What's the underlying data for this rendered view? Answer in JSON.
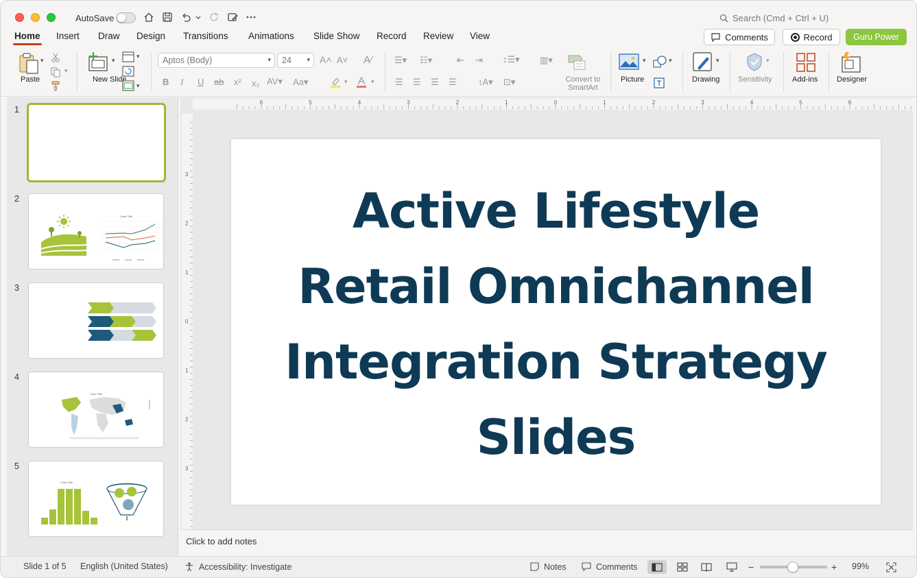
{
  "titlebar": {
    "autosave_label": "AutoSave",
    "search_placeholder": "Search (Cmd + Ctrl + U)"
  },
  "tabs": [
    {
      "label": "Home",
      "active": true
    },
    {
      "label": "Insert"
    },
    {
      "label": "Draw"
    },
    {
      "label": "Design"
    },
    {
      "label": "Transitions"
    },
    {
      "label": "Animations"
    },
    {
      "label": "Slide Show"
    },
    {
      "label": "Record"
    },
    {
      "label": "Review"
    },
    {
      "label": "View"
    }
  ],
  "actions": {
    "comments": "Comments",
    "record": "Record",
    "guru": "Guru Power"
  },
  "ribbon": {
    "paste": "Paste",
    "new_slide": "New Slide",
    "font_name": "Aptos (Body)",
    "font_size": "24",
    "convert_smartart": "Convert to SmartArt",
    "picture": "Picture",
    "drawing": "Drawing",
    "sensitivity": "Sensitivity",
    "addins": "Add-ins",
    "designer": "Designer"
  },
  "ruler": {
    "h_ticks": [
      "6",
      "5",
      "4",
      "3",
      "2",
      "1",
      "0",
      "1",
      "2",
      "3",
      "4",
      "5",
      "6"
    ],
    "v_ticks": [
      "3",
      "2",
      "1",
      "0",
      "1",
      "2",
      "3"
    ]
  },
  "thumbnails": [
    {
      "num": "1",
      "selected": true
    },
    {
      "num": "2",
      "chart_title": "Chart Title"
    },
    {
      "num": "3"
    },
    {
      "num": "4",
      "chart_title": "Chart Title"
    },
    {
      "num": "5",
      "chart_title": "Chart Title"
    }
  ],
  "slide": {
    "title_lines": [
      "Active Lifestyle",
      "Retail Omnichannel",
      "Integration Strategy",
      "Slides"
    ]
  },
  "notes": {
    "placeholder": "Click to add notes"
  },
  "statusbar": {
    "slide_info": "Slide 1 of 5",
    "language": "English (United States)",
    "accessibility": "Accessibility: Investigate",
    "notes": "Notes",
    "comments": "Comments",
    "zoom_minus": "−",
    "zoom_plus": "+",
    "zoom": "99%"
  },
  "colors": {
    "title": "#0e3a55",
    "accent_green": "#8dc63f",
    "tab_underline": "#c43e1c",
    "selection": "#a7b339"
  }
}
